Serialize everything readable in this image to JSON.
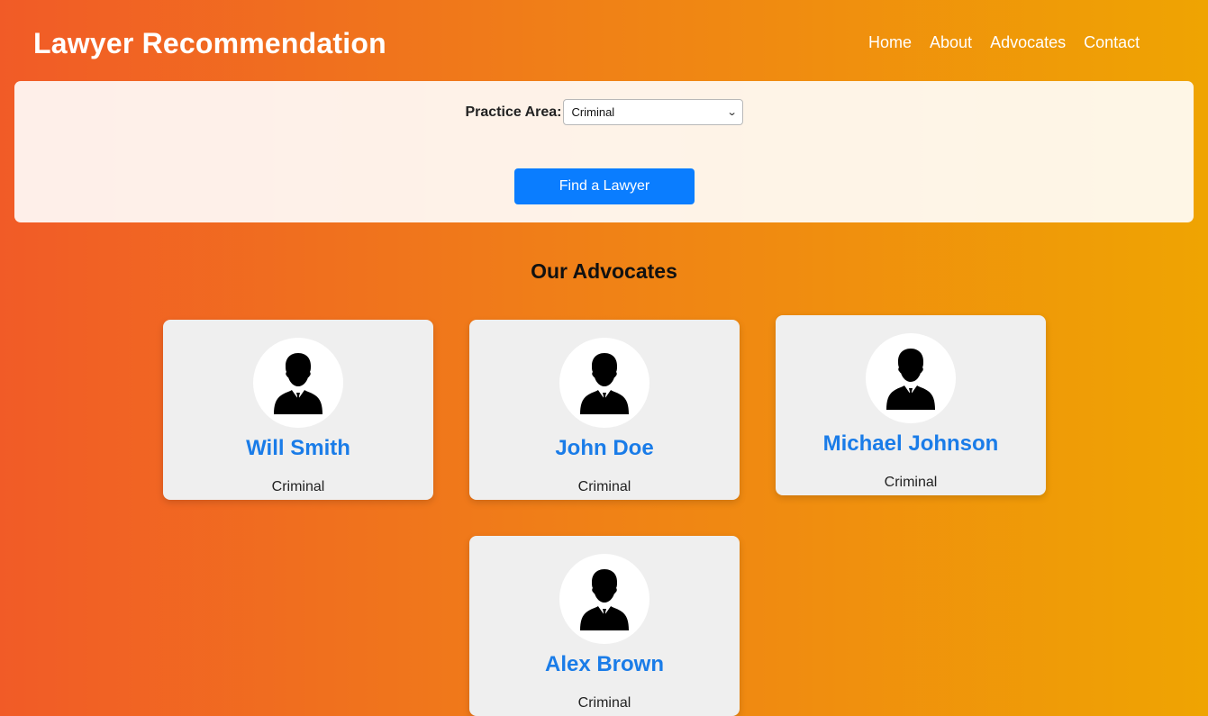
{
  "header": {
    "brand": "Lawyer Recommendation",
    "nav": [
      "Home",
      "About",
      "Advocates",
      "Contact"
    ]
  },
  "search": {
    "label": "Practice Area:",
    "selected": "Criminal",
    "button": "Find a Lawyer"
  },
  "section_title": "Our Advocates",
  "advocates": [
    {
      "name": "Will Smith",
      "practice_area": "Criminal",
      "icon": "lawyer-avatar-icon"
    },
    {
      "name": "John Doe",
      "practice_area": "Criminal",
      "icon": "lawyer-avatar-icon"
    },
    {
      "name": "Michael Johnson",
      "practice_area": "Criminal",
      "icon": "lawyer-avatar-icon"
    },
    {
      "name": "Alex Brown",
      "practice_area": "Criminal",
      "icon": "lawyer-avatar-icon"
    }
  ],
  "colors": {
    "gradient_start": "#f15b27",
    "gradient_end": "#efa402",
    "button": "#0a7dff",
    "name_text": "#1a7ce8",
    "card_bg": "#efefef"
  }
}
